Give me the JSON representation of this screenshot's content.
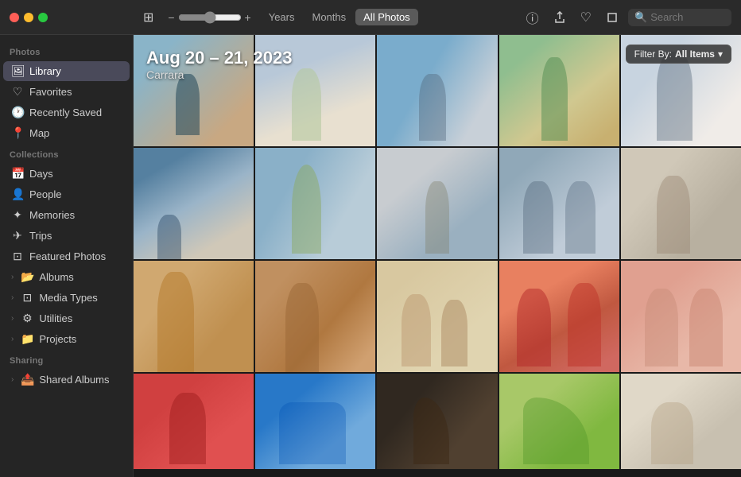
{
  "window": {
    "title": "Photos"
  },
  "toolbar": {
    "view_icon_label": "⊞",
    "zoom_min": "−",
    "zoom_max": "+",
    "zoom_value": 50,
    "view_tabs": [
      "Years",
      "Months",
      "All Photos"
    ],
    "active_tab": "All Photos",
    "info_icon": "ⓘ",
    "share_icon": "↑",
    "heart_icon": "♡",
    "crop_icon": "⊡",
    "search_placeholder": "Search"
  },
  "sidebar": {
    "photos_section": "Photos",
    "photos_items": [
      {
        "label": "Library",
        "icon": "🖼",
        "active": true
      },
      {
        "label": "Favorites",
        "icon": "♡"
      },
      {
        "label": "Recently Saved",
        "icon": "🕐"
      },
      {
        "label": "Map",
        "icon": "📍"
      }
    ],
    "collections_section": "Collections",
    "collections_items": [
      {
        "label": "Days",
        "icon": "📅"
      },
      {
        "label": "People",
        "icon": "👤"
      },
      {
        "label": "Memories",
        "icon": "✦"
      },
      {
        "label": "Trips",
        "icon": "✈"
      },
      {
        "label": "Featured Photos",
        "icon": "⊡"
      },
      {
        "label": "Albums",
        "icon": "📂",
        "expandable": true
      },
      {
        "label": "Media Types",
        "icon": "⊡",
        "expandable": true
      },
      {
        "label": "Utilities",
        "icon": "⚙",
        "expandable": true
      },
      {
        "label": "Projects",
        "icon": "📁",
        "expandable": true
      }
    ],
    "sharing_section": "Sharing",
    "sharing_items": [
      {
        "label": "Shared Albums",
        "icon": "📤",
        "expandable": true
      }
    ]
  },
  "content": {
    "date_label": "Aug 20 – 21, 2023",
    "location_label": "Carrara",
    "filter_label": "Filter By:",
    "filter_value": "All Items",
    "filter_chevron": "▾"
  }
}
